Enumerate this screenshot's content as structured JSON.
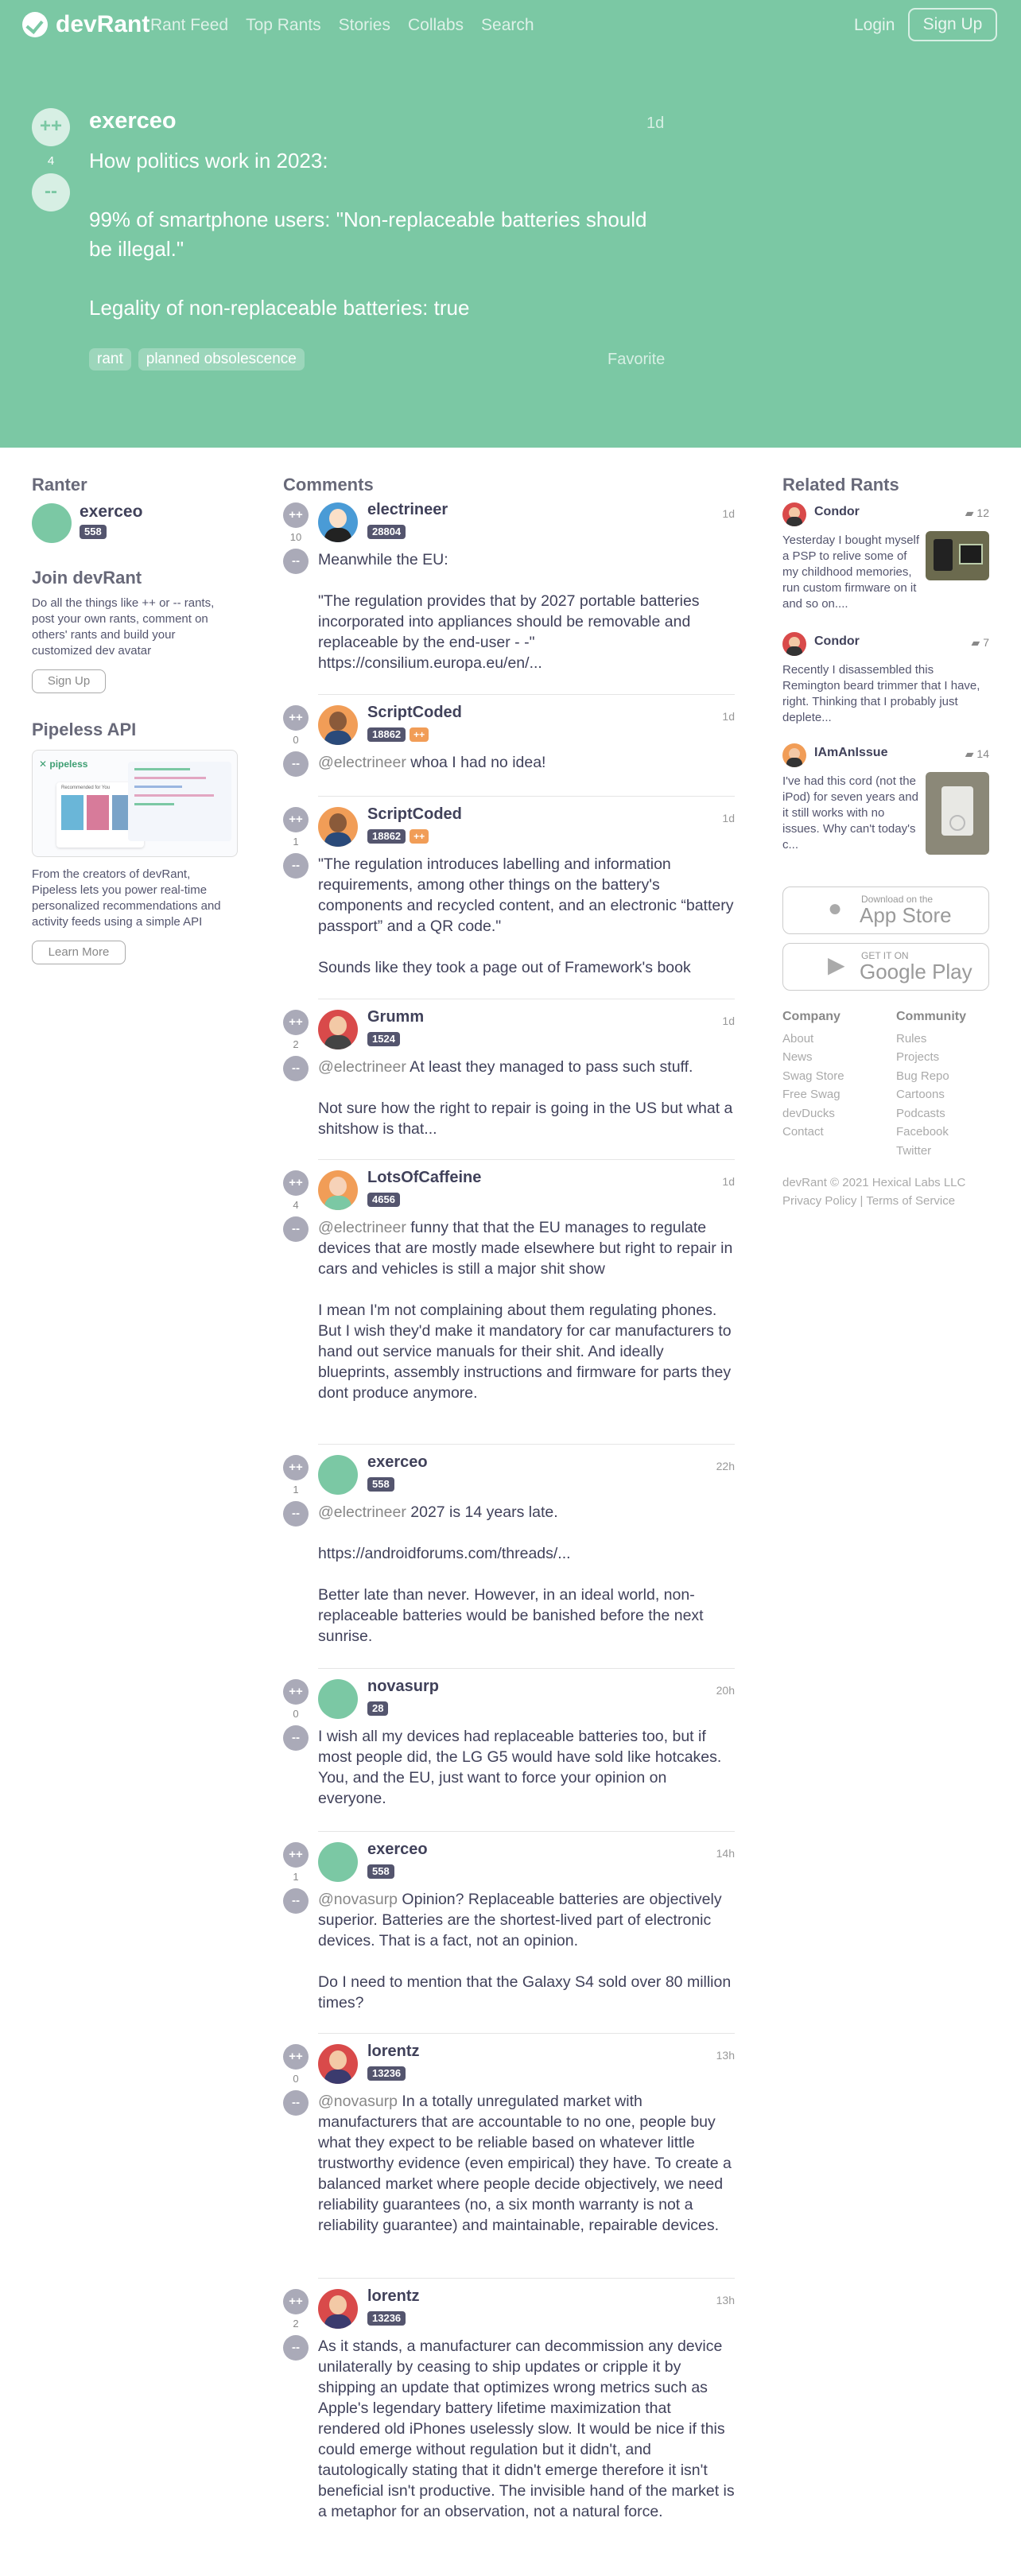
{
  "nav": {
    "brand": "devRant",
    "links": [
      "Rant Feed",
      "Top Rants",
      "Stories",
      "Collabs",
      "Search"
    ],
    "login": "Login",
    "signup": "Sign Up"
  },
  "rant": {
    "upvote": "++",
    "downvote": "--",
    "score": "4",
    "user": "exerceo",
    "time": "1d",
    "text": "How politics work in 2023:\n\n99% of smartphone users: \"Non-replaceable batteries should be illegal.\"\n\nLegality of non-replaceable batteries: true",
    "tags": [
      "rant",
      "planned obsolescence"
    ],
    "favorite": "Favorite"
  },
  "sidebar": {
    "ranter_title": "Ranter",
    "ranter_name": "exerceo",
    "ranter_score": "558",
    "join_title": "Join devRant",
    "join_text": "Do all the things like ++ or -- rants, post your own rants, comment on others' rants and build your customized dev avatar",
    "signup": "Sign Up",
    "api_title": "Pipeless API",
    "pipeless_logo": "pipeless",
    "pipeless_card_heading": "Recommended for You",
    "api_text": "From the creators of devRant, Pipeless lets you power real-time personalized recommendations and activity feeds using a simple API",
    "learn_more": "Learn More"
  },
  "comments_title": "Comments",
  "comments": [
    {
      "user": "electrineer",
      "score": "28804",
      "votes": "10",
      "time": "1d",
      "mention": "",
      "text": "Meanwhile the EU:\n\n\"The regulation provides that by 2027 portable batteries incorporated into appliances should be removable and replaceable by the end-user - -\"\nhttps://consilium.europa.eu/en/..."
    },
    {
      "user": "ScriptCoded",
      "score": "18862",
      "pp": "++",
      "votes": "0",
      "time": "1d",
      "mention": "@electrineer",
      "text": " whoa I had no idea!"
    },
    {
      "user": "ScriptCoded",
      "score": "18862",
      "pp": "++",
      "votes": "1",
      "time": "1d",
      "mention": "",
      "text": "\"The regulation introduces labelling and information requirements, among other things on the battery's components and recycled content, and an electronic “battery passport” and a QR code.\"\n\nSounds like they took a page out of Framework's book"
    },
    {
      "user": "Grumm",
      "score": "1524",
      "votes": "2",
      "time": "1d",
      "mention": "@electrineer",
      "text": " At least they managed to pass such stuff.\n\nNot sure how the right to repair is going in the US but what a shitshow is that..."
    },
    {
      "user": "LotsOfCaffeine",
      "score": "4656",
      "votes": "4",
      "time": "1d",
      "mention": "@electrineer",
      "text": " funny that that the EU manages to regulate devices that are mostly made elsewhere but right to repair in cars and vehicles is still a major shit show\n\nI mean I'm not complaining about them regulating phones.\nBut I wish they'd make it mandatory for car manufacturers to hand out service manuals for their shit. And ideally blueprints, assembly instructions and firmware for parts they dont produce anymore."
    },
    {
      "user": "exerceo",
      "score": "558",
      "votes": "1",
      "time": "22h",
      "mention": "@electrineer",
      "text": " 2027 is 14 years late.\n\nhttps://androidforums.com/threads/...\n\nBetter late than never. However, in an ideal world, non-replaceable batteries would be banished before the next sunrise."
    },
    {
      "user": "novasurp",
      "score": "28",
      "votes": "0",
      "time": "20h",
      "mention": "",
      "text": "I wish all my devices had replaceable batteries too, but if most people did, the LG G5 would have sold like hotcakes. You, and the EU, just want to force your opinion on everyone."
    },
    {
      "user": "exerceo",
      "score": "558",
      "votes": "1",
      "time": "14h",
      "mention": "@novasurp",
      "text": " Opinion? Replaceable batteries are objectively superior. Batteries are the shortest-lived part of electronic devices. That is a fact, not an opinion.\n\nDo I need to mention that the Galaxy S4 sold over 80 million times?"
    },
    {
      "user": "lorentz",
      "score": "13236",
      "votes": "0",
      "time": "13h",
      "mention": "@novasurp",
      "text": " In a totally unregulated market with manufacturers that are accountable to no one, people buy what they expect to be reliable based on whatever little trustworthy evidence (even empirical) they have. To create a balanced market where people decide objectively, we need reliability guarantees (no, a six month warranty is not a reliability guarantee) and maintainable, repairable devices."
    },
    {
      "user": "lorentz",
      "score": "13236",
      "votes": "2",
      "time": "13h",
      "mention": "",
      "text": "As it stands, a manufacturer can decommission any device unilaterally by ceasing to ship updates or cripple it by shipping an update that optimizes wrong metrics such as Apple's legendary battery lifetime maximization that rendered old iPhones uselessly slow. It would be nice if this could emerge without regulation but it didn't, and tautologically stating that it didn't emerge therefore it isn't beneficial isn't productive. The invisible hand of the market is a metaphor for an observation, not a natural force."
    }
  ],
  "related": {
    "title": "Related Rants",
    "items": [
      {
        "user": "Condor",
        "count": "12",
        "text": "Yesterday I bought myself a PSP to relive some of my childhood memories, run custom firmware on it and so on...."
      },
      {
        "user": "Condor",
        "count": "7",
        "text": "Recently I disassembled this Remington beard trimmer that I have, right. Thinking that I probably just deplete..."
      },
      {
        "user": "IAmAnIssue",
        "count": "14",
        "text": "I've had this cord (not the iPod) for seven years and it still works with no issues. Why can't today's c..."
      }
    ]
  },
  "stores": {
    "apple_small": "Download on the",
    "apple_big": "App Store",
    "google_small": "GET IT ON",
    "google_big": "Google Play"
  },
  "footer": {
    "company_title": "Company",
    "company": [
      "About",
      "News",
      "Swag Store",
      "Free Swag",
      "devDucks",
      "Contact"
    ],
    "community_title": "Community",
    "community": [
      "Rules",
      "Projects",
      "Bug Repo",
      "Cartoons",
      "Podcasts",
      "Facebook",
      "Twitter"
    ],
    "copyright": "devRant © 2021 Hexical Labs LLC",
    "privacy": "Privacy Policy",
    "divider": "|",
    "terms": "Terms of Service"
  },
  "colors": {
    "brand": "#7bc8a4",
    "badge": "#54556e",
    "pp_badge": "#f19d57"
  }
}
